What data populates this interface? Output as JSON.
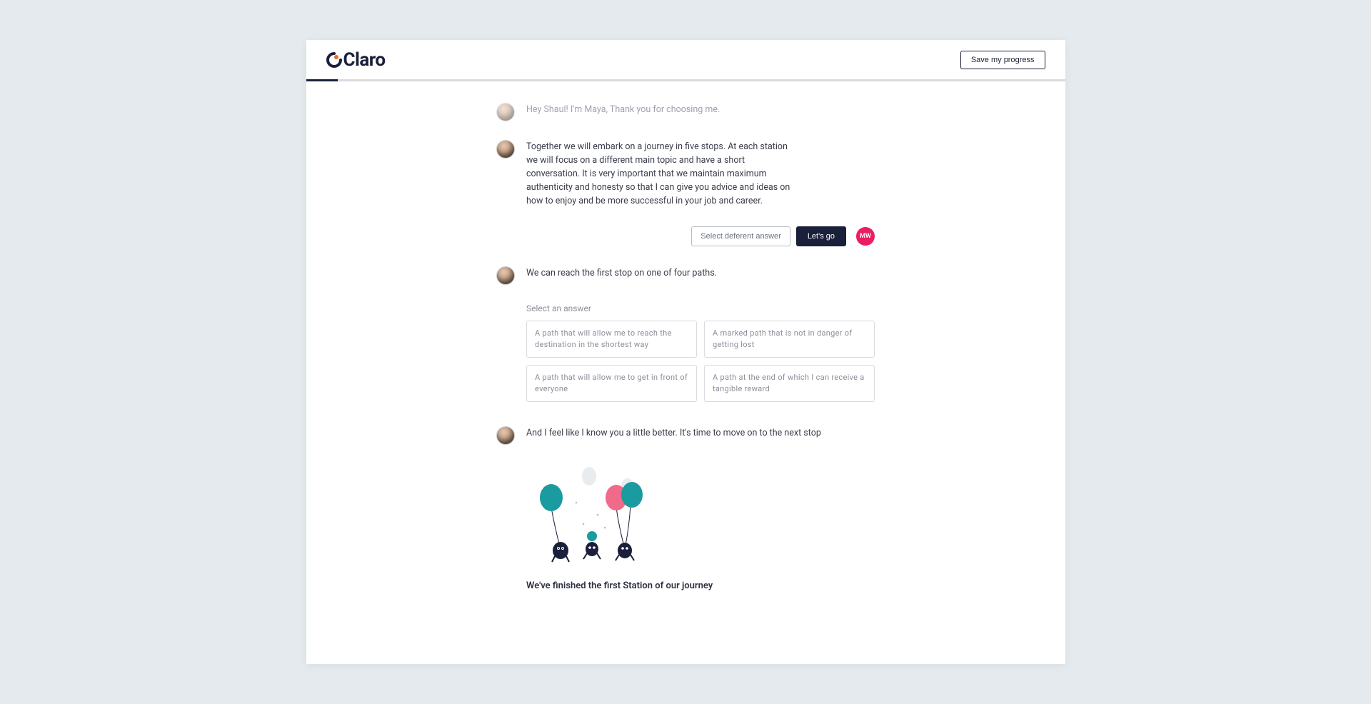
{
  "brand": {
    "name": "Claro"
  },
  "header": {
    "save_label": "Save my progress"
  },
  "chat": {
    "greeting": "Hey Shaul! I'm Maya, Thank you for choosing me.",
    "intro": "Together we will embark on a journey in five stops. At each station we will focus on a different main topic and have a short conversation. It is very important that we maintain maximum authenticity and honesty so that I can give you advice and ideas on how to enjoy and be more successful in your job and career.",
    "actions": {
      "select_different": "Select deferent answer",
      "lets_go": "Let's go"
    },
    "user_initials": "MW",
    "paths_intro": "We can reach the first stop on one of four paths.",
    "select_prompt": "Select an answer",
    "options": [
      "A path that will allow me to reach the destination in the shortest way",
      "A marked path that is not in danger of getting lost",
      "A path that will allow me to get in front of everyone",
      "A path at the end of which I can receive a tangible reward"
    ],
    "closing": "And I feel like I know you a little better. It's time to move on to the next stop",
    "finished": "We've finished the first Station of our journey"
  }
}
